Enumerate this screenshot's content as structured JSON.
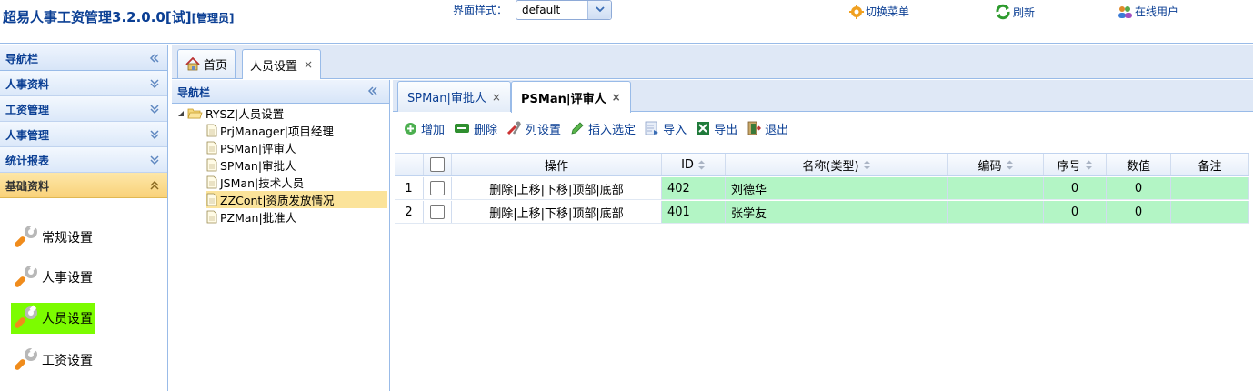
{
  "header": {
    "title_main": "超易人事工资管理3.2.0.0[试]",
    "title_role": "[管理员]",
    "theme_label": "界面样式：",
    "theme_value": "default",
    "links": {
      "switch_menu": "切换菜单",
      "refresh": "刷新",
      "online_users": "在线用户"
    }
  },
  "left_nav": {
    "title": "导航栏",
    "sections": [
      "人事资料",
      "工资管理",
      "人事管理",
      "统计报表",
      "基础资料"
    ],
    "active_section": "基础资料",
    "items": [
      "常规设置",
      "人事设置",
      "人员设置",
      "工资设置"
    ],
    "selected_item": "人员设置"
  },
  "outer_tabs": {
    "home": "首页",
    "current": "人员设置"
  },
  "tree": {
    "title": "导航栏",
    "root": "RYSZ|人员设置",
    "children": [
      "PrjManager|项目经理",
      "PSMan|评审人",
      "SPMan|审批人",
      "JSMan|技术人员",
      "ZZCont|资质发放情况",
      "PZMan|批准人"
    ],
    "selected": "ZZCont|资质发放情况"
  },
  "inner_tabs": [
    "SPMan|审批人",
    "PSMan|评审人"
  ],
  "inner_active": "PSMan|评审人",
  "toolbar": {
    "add": "增加",
    "delete": "删除",
    "columns": "列设置",
    "insert": "插入选定",
    "import": "导入",
    "export": "导出",
    "exit": "退出"
  },
  "grid": {
    "columns": {
      "action": "操作",
      "id": "ID",
      "name": "名称(类型)",
      "code": "编码",
      "seq": "序号",
      "value": "数值",
      "remark": "备注"
    },
    "rows": [
      {
        "num": "1",
        "action": "删除|上移|下移|顶部|底部",
        "id": "402",
        "name": "刘德华",
        "code": "",
        "seq": "0",
        "value": "0",
        "remark": ""
      },
      {
        "num": "2",
        "action": "删除|上移|下移|顶部|底部",
        "id": "401",
        "name": "张学友",
        "code": "",
        "seq": "0",
        "value": "0",
        "remark": ""
      }
    ]
  },
  "colors": {
    "accent": "#0b3f94",
    "border": "#99bbe8",
    "row_highlight": "#b3f5c5",
    "selected_item": "#7cfc00",
    "tree_selected": "#fbe39a"
  }
}
